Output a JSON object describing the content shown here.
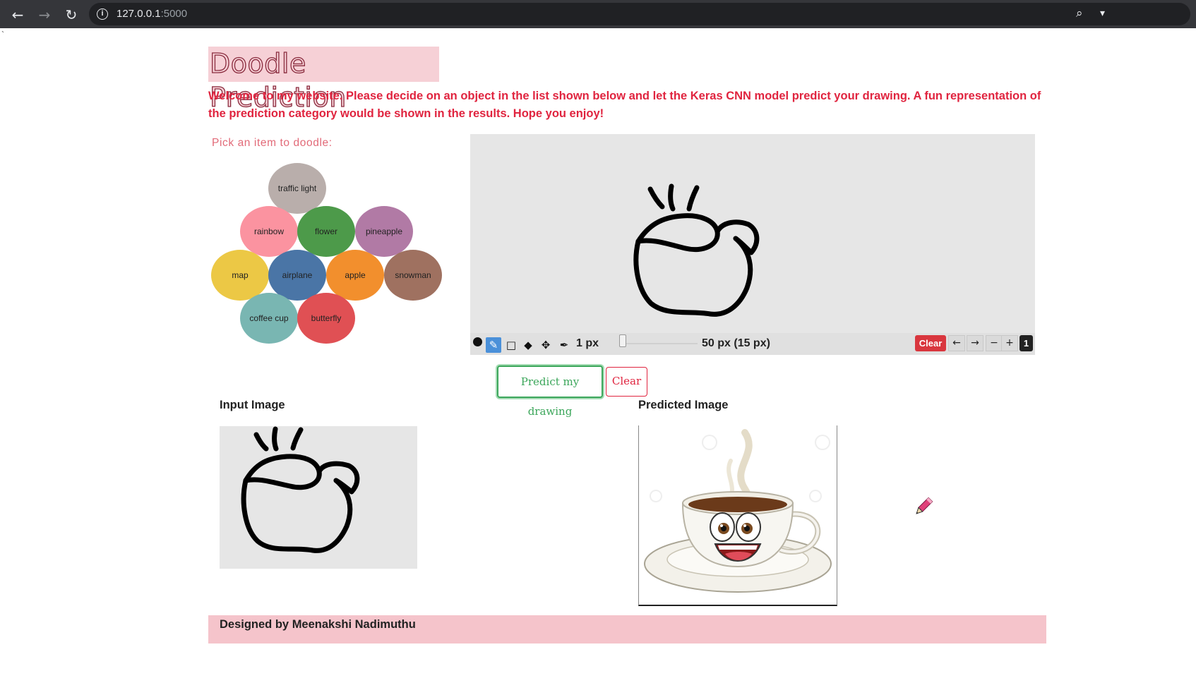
{
  "browser": {
    "url_host": "127.0.0.1",
    "url_port": ":5000"
  },
  "stray_char": "`",
  "page": {
    "title": "Doodle Prediction",
    "intro": "Welcome to my website. Please decide on an object in the list shown below and let the Keras CNN model predict your drawing. A fun representation of the prediction category would be shown in the results. Hope you enjoy!",
    "pick_label": "Pick an item to doodle:"
  },
  "items": [
    {
      "label": "traffic light",
      "color": "#b9aeab"
    },
    {
      "label": "rainbow",
      "color": "#fb93a0"
    },
    {
      "label": "flower",
      "color": "#4d9a4a"
    },
    {
      "label": "pineapple",
      "color": "#b17aa5"
    },
    {
      "label": "map",
      "color": "#ecc845"
    },
    {
      "label": "airplane",
      "color": "#4a75a6"
    },
    {
      "label": "apple",
      "color": "#f28f2d"
    },
    {
      "label": "snowman",
      "color": "#9f7160"
    },
    {
      "label": "coffee cup",
      "color": "#79b6b2"
    },
    {
      "label": "butterfly",
      "color": "#e05054"
    }
  ],
  "toolbar": {
    "brush_size": "1 px",
    "size_readout": "50 px (15 px)",
    "clear_label": "Clear",
    "undo_glyph": "←",
    "redo_glyph": "→",
    "zoom_out_glyph": "−",
    "zoom_in_glyph": "+",
    "zoom_level": "1"
  },
  "actions": {
    "predict_label": "Predict my drawing",
    "clear_label": "Clear"
  },
  "results": {
    "input_label": "Input Image",
    "predicted_label": "Predicted Image"
  },
  "footer": {
    "credit": "Designed by Meenakshi Nadimuthu"
  },
  "colors": {
    "accent_red": "#e0243f",
    "title_bg": "#f6d0d6",
    "footer_bg": "#f5c4cb",
    "predict_green": "#3ba65a"
  }
}
